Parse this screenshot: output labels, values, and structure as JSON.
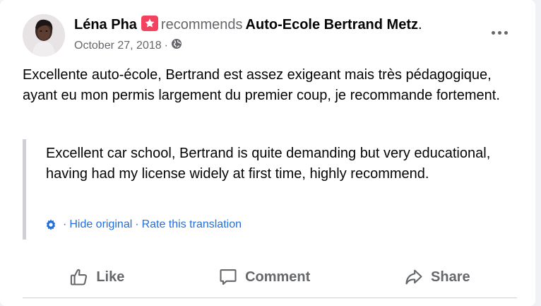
{
  "post": {
    "author": "Léna Pha",
    "action_word": "recommends",
    "page_name": "Auto-Ecole Bertrand Metz",
    "trailing_dot": ".",
    "date": "October 27, 2018",
    "date_separator": "·",
    "privacy_icon": "globe-icon",
    "body": "Excellente auto-école, Bertrand est assez exigeant mais très pédagogique, ayant eu mon permis largement du premier coup, je recommande fortement.",
    "translation": "Excellent car school, Bertrand is quite demanding but very educational, having had my license widely at first time, highly recommend.",
    "hide_original": "Hide original",
    "rate_translation": "Rate this translation",
    "link_separator": "·"
  },
  "actions": {
    "like": "Like",
    "comment": "Comment",
    "share": "Share"
  },
  "colors": {
    "link": "#216fdb",
    "secondary_text": "#65676b",
    "recommend_badge": "#f3425f"
  }
}
